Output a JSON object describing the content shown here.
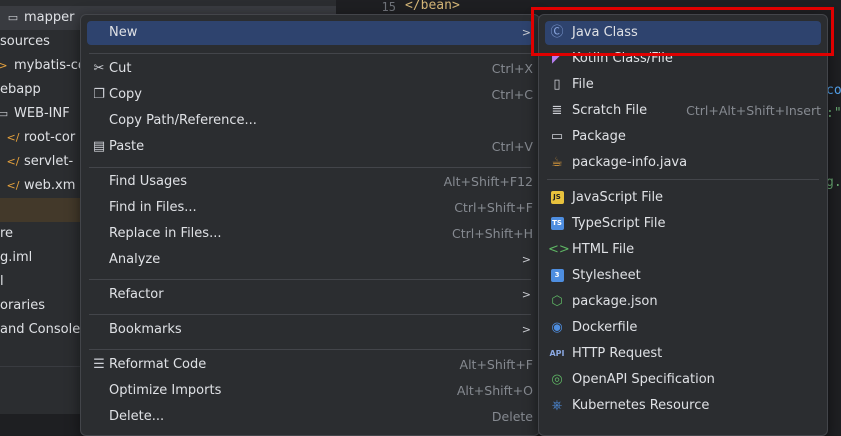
{
  "tree": {
    "rows": [
      {
        "label": "mapper",
        "icon": "folder-icon",
        "glyph": "▭",
        "color": "#ced0d6"
      },
      {
        "label": "sources",
        "icon": "",
        "glyph": "",
        "color": "#dfe1e5"
      },
      {
        "label": "mybatis-co",
        "icon": "xml-icon",
        "glyph": ">",
        "color": "#e8a33d"
      },
      {
        "label": "ebapp",
        "icon": "",
        "glyph": "",
        "color": "#dfe1e5"
      },
      {
        "label": "WEB-INF",
        "icon": "folder-icon",
        "glyph": "▭",
        "color": "#ced0d6"
      },
      {
        "label": "root-cor",
        "icon": "xml-icon",
        "glyph": "</",
        "color": "#e8a33d"
      },
      {
        "label": "servlet-",
        "icon": "xml-icon",
        "glyph": "</",
        "color": "#e8a33d"
      },
      {
        "label": "web.xm",
        "icon": "web-xml-icon",
        "glyph": "</",
        "color": "#e8a33d"
      },
      {
        "label": "",
        "icon": "",
        "glyph": "",
        "color": "#dfe1e5"
      },
      {
        "label": "re",
        "icon": "",
        "glyph": "",
        "color": "#dfe1e5"
      },
      {
        "label": "g.iml",
        "icon": "",
        "glyph": "",
        "color": "#dfe1e5"
      },
      {
        "label": "l",
        "icon": "",
        "glyph": "",
        "color": "#dfe1e5"
      },
      {
        "label": "oraries",
        "icon": "",
        "glyph": "",
        "color": "#dfe1e5"
      },
      {
        "label": "and Console",
        "icon": "",
        "glyph": "",
        "color": "#dfe1e5"
      }
    ]
  },
  "editor": {
    "line_number": "15",
    "top_code": "</bean>",
    "side_fragments": [
      "co",
      ":\"m",
      "g.",
      ""
    ]
  },
  "menu": {
    "items": [
      {
        "label": "New",
        "icon": "",
        "shortcut": "",
        "arrow": true,
        "highlight": true
      },
      {
        "label": "Cut",
        "icon": "scissors-icon",
        "shortcut": "Ctrl+X"
      },
      {
        "label": "Copy",
        "icon": "copy-icon",
        "shortcut": "Ctrl+C"
      },
      {
        "label": "Copy Path/Reference...",
        "icon": "",
        "shortcut": ""
      },
      {
        "label": "Paste",
        "icon": "paste-icon",
        "shortcut": "Ctrl+V"
      },
      {
        "label": "Find Usages",
        "icon": "",
        "shortcut": "Alt+Shift+F12"
      },
      {
        "label": "Find in Files...",
        "icon": "",
        "shortcut": "Ctrl+Shift+F"
      },
      {
        "label": "Replace in Files...",
        "icon": "",
        "shortcut": "Ctrl+Shift+H"
      },
      {
        "label": "Analyze",
        "icon": "",
        "shortcut": "",
        "arrow": true
      },
      {
        "label": "Refactor",
        "icon": "",
        "shortcut": "",
        "arrow": true
      },
      {
        "label": "Bookmarks",
        "icon": "",
        "shortcut": "",
        "arrow": true
      },
      {
        "label": "Reformat Code",
        "icon": "reformat-icon",
        "shortcut": "Alt+Shift+F"
      },
      {
        "label": "Optimize Imports",
        "icon": "",
        "shortcut": "Alt+Shift+O"
      },
      {
        "label": "Delete...",
        "icon": "",
        "shortcut": "Delete"
      }
    ]
  },
  "submenu": {
    "items": [
      {
        "label": "Java Class",
        "icon": "java-class-icon",
        "shortcut": "",
        "highlight": true
      },
      {
        "label": "Kotlin Class/File",
        "icon": "kotlin-icon",
        "shortcut": ""
      },
      {
        "label": "File",
        "icon": "file-icon",
        "shortcut": ""
      },
      {
        "label": "Scratch File",
        "icon": "scratch-file-icon",
        "shortcut": "Ctrl+Alt+Shift+Insert"
      },
      {
        "label": "Package",
        "icon": "package-icon",
        "shortcut": ""
      },
      {
        "label": "package-info.java",
        "icon": "package-info-icon",
        "shortcut": ""
      },
      {
        "label": "JavaScript File",
        "icon": "javascript-icon",
        "shortcut": ""
      },
      {
        "label": "TypeScript File",
        "icon": "typescript-icon",
        "shortcut": ""
      },
      {
        "label": "HTML File",
        "icon": "html-icon",
        "shortcut": ""
      },
      {
        "label": "Stylesheet",
        "icon": "css-icon",
        "shortcut": ""
      },
      {
        "label": "package.json",
        "icon": "nodejs-icon",
        "shortcut": ""
      },
      {
        "label": "Dockerfile",
        "icon": "docker-icon",
        "shortcut": ""
      },
      {
        "label": "HTTP Request",
        "icon": "api-icon",
        "shortcut": ""
      },
      {
        "label": "OpenAPI Specification",
        "icon": "openapi-icon",
        "shortcut": ""
      },
      {
        "label": "Kubernetes Resource",
        "icon": "kubernetes-icon",
        "shortcut": ""
      }
    ]
  },
  "colors": {
    "menu_bg": "#2b2d30",
    "highlight": "#2e436e",
    "annotation": "#e00000"
  }
}
